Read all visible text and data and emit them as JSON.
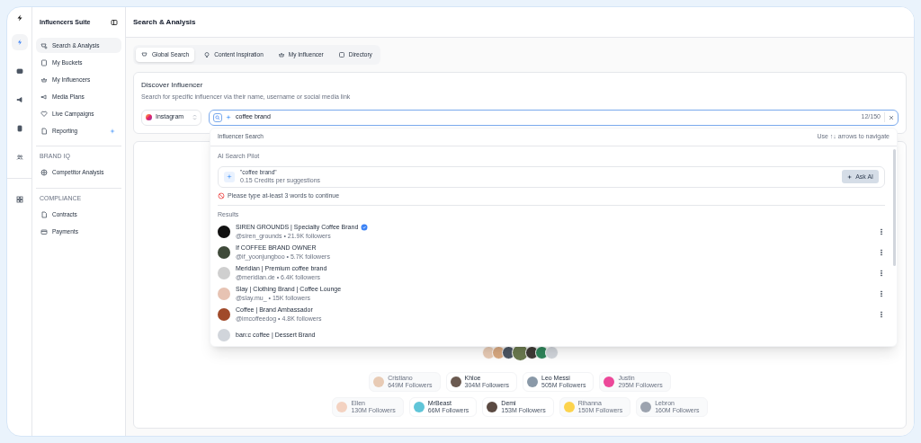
{
  "rail": {
    "items": [
      {
        "selected": true
      },
      {
        "selected": false
      },
      {
        "selected": false
      },
      {
        "selected": false
      },
      {
        "selected": false
      },
      {
        "selected": false
      }
    ]
  },
  "sidebar": {
    "title": "Influencers Suite",
    "sections": [
      {
        "items": [
          {
            "label": "Search & Analysis",
            "selected": true,
            "ai": false
          },
          {
            "label": "My Buckets",
            "selected": false,
            "ai": false
          },
          {
            "label": "My Influencers",
            "selected": false,
            "ai": false
          },
          {
            "label": "Media Plans",
            "selected": false,
            "ai": false
          },
          {
            "label": "Live Campaigns",
            "selected": false,
            "ai": false
          },
          {
            "label": "Reporting",
            "selected": false,
            "ai": true
          }
        ]
      },
      {
        "heading": "BRAND IQ",
        "items": [
          {
            "label": "Competitor Analysis",
            "selected": false,
            "ai": false
          }
        ]
      },
      {
        "heading": "COMPLIANCE",
        "items": [
          {
            "label": "Contracts",
            "selected": false,
            "ai": false
          },
          {
            "label": "Payments",
            "selected": false,
            "ai": false
          }
        ]
      }
    ]
  },
  "page_title": "Search & Analysis",
  "tabs": [
    {
      "label": "Global Search",
      "selected": true
    },
    {
      "label": "Content Inspiration",
      "selected": false
    },
    {
      "label": "My Influencer",
      "selected": false
    },
    {
      "label": "Directory",
      "selected": false
    }
  ],
  "discover": {
    "title": "Discover Influencer",
    "subtitle": "Search for specific influencer via their name, username or social media link",
    "platform": "Instagram",
    "query": "coffee brand",
    "counter": "12/150"
  },
  "dropdown": {
    "title": "Influencer Search",
    "hint": "Use ↑↓ arrows to navigate",
    "ai_heading": "AI Search Pilot",
    "ai_query": "\"coffee brand\"",
    "ai_credits": "0.15 Credits per suggestions",
    "ai_button": "Ask AI",
    "warning": "Please type at-least 3 words to continue",
    "results_heading": "Results",
    "results": [
      {
        "name": "SIREN GROUNDS | Specialty Coffee Brand",
        "handle": "@siren_grounds • 21.9K followers",
        "verified": true
      },
      {
        "name": "If COFFEE BRAND OWNER",
        "handle": "@if_yoonjungboo • 5.7K followers",
        "verified": false
      },
      {
        "name": "Meridian | Premium coffee brand",
        "handle": "@meridian.de • 6.4K followers",
        "verified": false
      },
      {
        "name": "Slay | Clothing Brand | Coffee Lounge",
        "handle": "@slay.mu_ • 15K followers",
        "verified": false
      },
      {
        "name": "Coffee | Brand Ambassador",
        "handle": "@imcoffeedog • 4.8K followers",
        "verified": false
      },
      {
        "name": "ban:c coffee | Dessert Brand",
        "verified": false
      }
    ]
  },
  "featured": {
    "rows": [
      [
        {
          "name": "Cristiano",
          "followers": "649M Followers",
          "faded": true
        },
        {
          "name": "Khloe",
          "followers": "304M Followers",
          "faded": false
        },
        {
          "name": "Leo Messi",
          "followers": "505M Followers",
          "faded": false
        },
        {
          "name": "Justin",
          "followers": "295M Followers",
          "faded": true
        }
      ],
      [
        {
          "name": "Ellen",
          "followers": "130M Followers",
          "faded": true
        },
        {
          "name": "MrBeast",
          "followers": "66M Followers",
          "faded": false
        },
        {
          "name": "Demi",
          "followers": "153M Followers",
          "faded": false
        },
        {
          "name": "Rihanna",
          "followers": "150M Followers",
          "faded": true
        },
        {
          "name": "Lebron",
          "followers": "160M Followers",
          "faded": true
        }
      ]
    ]
  }
}
